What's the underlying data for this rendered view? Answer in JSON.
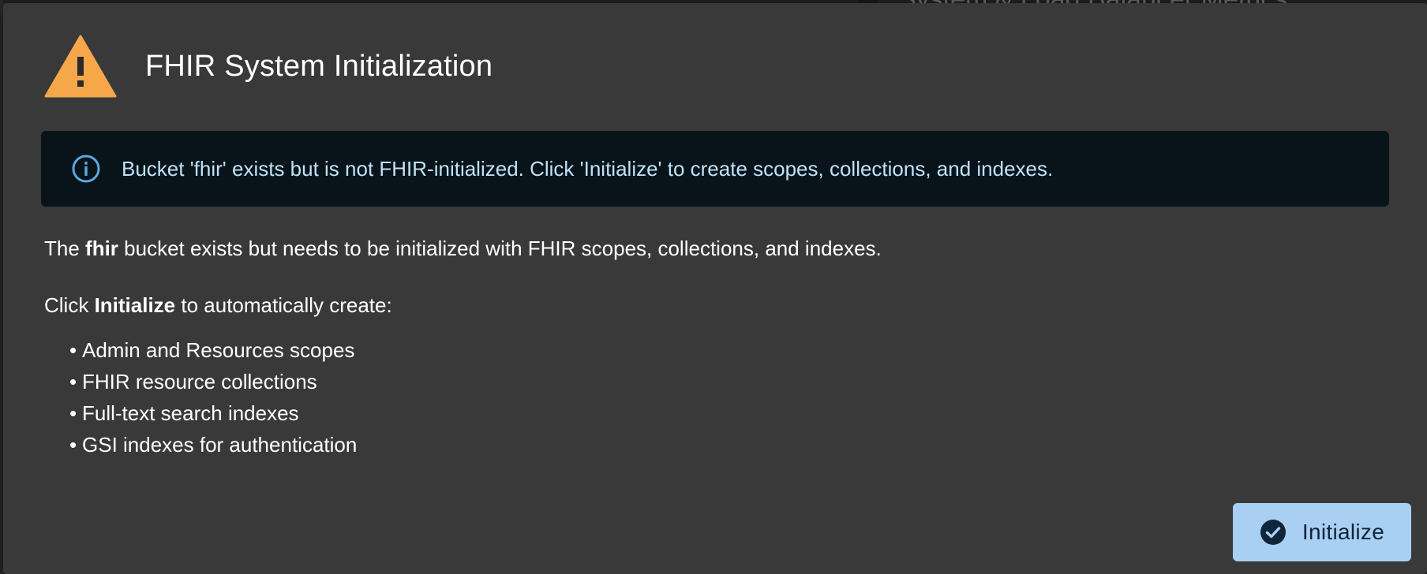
{
  "backdrop": {
    "partial_title": "System & Load Balancer Metrics"
  },
  "dialog": {
    "title": "FHIR System Initialization",
    "alert_icon": "warning-triangle-icon",
    "info_icon": "info-circle-icon",
    "info_message": "Bucket 'fhir' exists but is not FHIR-initialized. Click 'Initialize' to create scopes, collections, and indexes.",
    "paragraph1": {
      "before": "The ",
      "bold": "fhir",
      "after": " bucket exists but needs to be initialized with FHIR scopes, collections, and indexes."
    },
    "paragraph2": {
      "before": "Click ",
      "bold": "Initialize",
      "after": " to automatically create:"
    },
    "bullet_char": "•",
    "items": [
      "Admin and Resources scopes",
      "FHIR resource collections",
      "Full-text search indexes",
      "GSI indexes for authentication"
    ],
    "button": {
      "label": "Initialize",
      "icon": "check-circle-icon"
    }
  },
  "colors": {
    "dialog_bg": "#393939",
    "warning": "#f5a74a",
    "info_bg": "#09131a",
    "info_text": "#bfe2f5",
    "info_icon": "#5aa8e0",
    "button_bg": "#a9cff3",
    "button_text": "#10243a"
  }
}
